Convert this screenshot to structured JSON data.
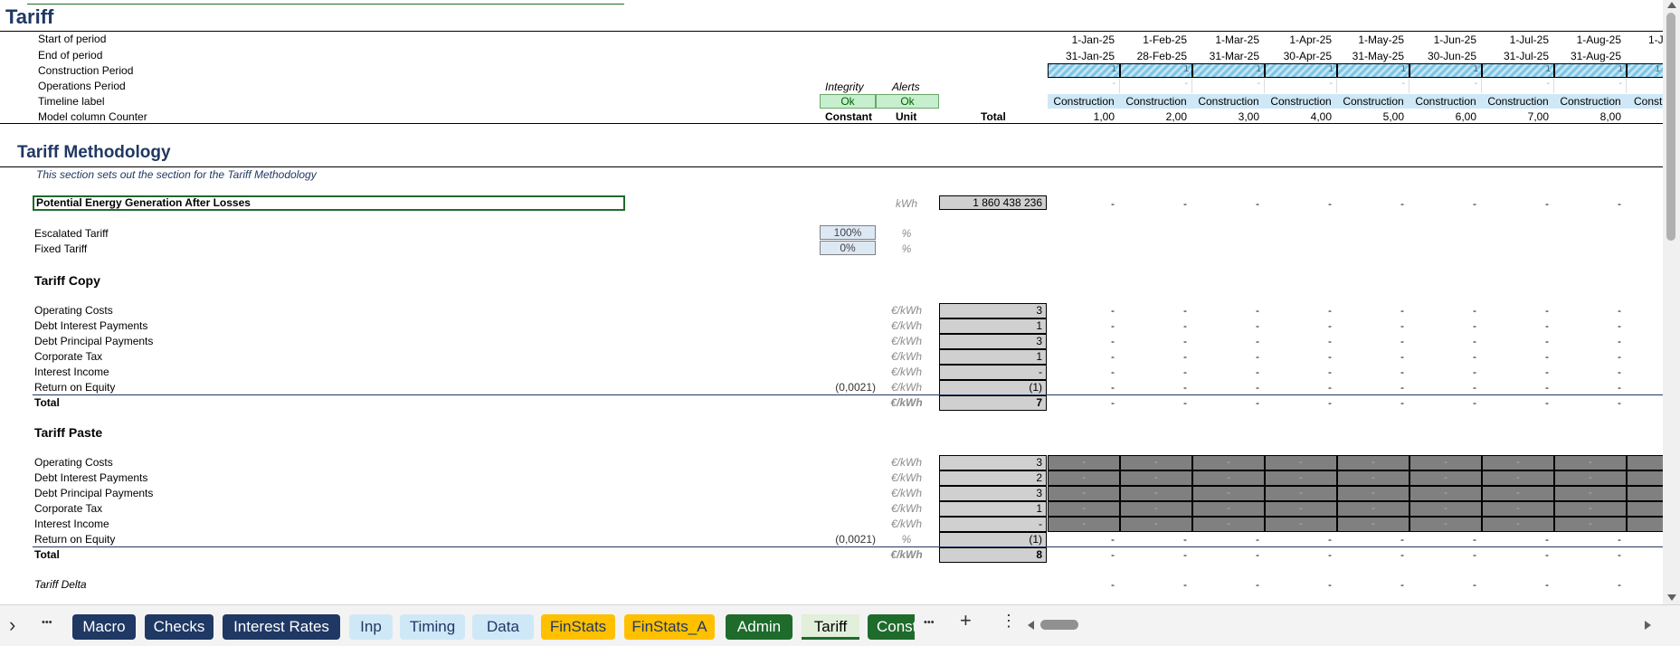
{
  "sheet_title": "Tariff",
  "timeline_labels": [
    "Start of period",
    "End of period",
    "Construction Period",
    "Operations Period",
    "Timeline label",
    "Model column Counter"
  ],
  "start_dates": [
    "1-Jan-25",
    "1-Feb-25",
    "1-Mar-25",
    "1-Apr-25",
    "1-May-25",
    "1-Jun-25",
    "1-Jul-25",
    "1-Aug-25"
  ],
  "end_dates": [
    "31-Jan-25",
    "28-Feb-25",
    "31-Mar-25",
    "30-Apr-25",
    "31-May-25",
    "30-Jun-25",
    "31-Jul-25",
    "31-Aug-25"
  ],
  "construction_flag": "1",
  "ops_flag": "-",
  "timeline_label_value": "Construction",
  "counters": [
    "1,00",
    "2,00",
    "3,00",
    "4,00",
    "5,00",
    "6,00",
    "7,00",
    "8,00"
  ],
  "integrity_header": "Integrity",
  "alerts_header": "Alerts",
  "integrity_status": "Ok",
  "alerts_status": "Ok",
  "constant_header": "Constant",
  "unit_header": "Unit",
  "total_header": "Total",
  "methodology": {
    "title": "Tariff Methodology",
    "description": "This section sets out the section for the Tariff Methodology",
    "energy_label": "Potential Energy Generation After Losses",
    "energy_unit": "kWh",
    "energy_total": "1 860 438 236",
    "escalated_label": "Escalated Tariff",
    "escalated_value": "100%",
    "fixed_label": "Fixed Tariff",
    "fixed_value": "0%",
    "pct_unit": "%"
  },
  "dash": "-",
  "tariff_copy": {
    "title": "Tariff Copy",
    "rows": [
      {
        "label": "Operating Costs",
        "unit": "€/kWh",
        "total": "3",
        "constant": ""
      },
      {
        "label": "Debt Interest  Payments",
        "unit": "€/kWh",
        "total": "1",
        "constant": ""
      },
      {
        "label": "Debt Principal  Payments",
        "unit": "€/kWh",
        "total": "3",
        "constant": ""
      },
      {
        "label": "Corporate Tax",
        "unit": "€/kWh",
        "total": "1",
        "constant": ""
      },
      {
        "label": "Interest Income",
        "unit": "€/kWh",
        "total": "-",
        "constant": ""
      },
      {
        "label": "Return on Equity",
        "unit": "€/kWh",
        "total": "(1)",
        "constant": "(0,0021)"
      }
    ],
    "total_label": "Total",
    "total_unit": "€/kWh",
    "total_value": "7"
  },
  "tariff_paste": {
    "title": "Tariff Paste",
    "rows": [
      {
        "label": "Operating Costs",
        "unit": "€/kWh",
        "total": "3",
        "constant": ""
      },
      {
        "label": "Debt Interest  Payments",
        "unit": "€/kWh",
        "total": "2",
        "constant": ""
      },
      {
        "label": "Debt Principal  Payments",
        "unit": "€/kWh",
        "total": "3",
        "constant": ""
      },
      {
        "label": "Corporate Tax",
        "unit": "€/kWh",
        "total": "1",
        "constant": ""
      },
      {
        "label": "Interest Income",
        "unit": "€/kWh",
        "total": "-",
        "constant": ""
      },
      {
        "label": "Return on Equity",
        "unit": "%",
        "total": "(1)",
        "constant": "(0,0021)"
      }
    ],
    "total_label": "Total",
    "total_unit": "€/kWh",
    "total_value": "8"
  },
  "tariff_delta_label": "Tariff Delta",
  "tabs": [
    {
      "label": "Macro",
      "bg": "#1f3864",
      "fg": "#ffffff"
    },
    {
      "label": "Checks",
      "bg": "#1f3864",
      "fg": "#ffffff"
    },
    {
      "label": "Interest Rates",
      "bg": "#1f3864",
      "fg": "#ffffff"
    },
    {
      "label": "Inp",
      "bg": "#cfe8f7",
      "fg": "#1f3864"
    },
    {
      "label": "Timing",
      "bg": "#cfe8f7",
      "fg": "#1f3864"
    },
    {
      "label": "Data",
      "bg": "#cfe8f7",
      "fg": "#1f3864"
    },
    {
      "label": "FinStats",
      "bg": "#ffc000",
      "fg": "#1f3864"
    },
    {
      "label": "FinStats_A",
      "bg": "#ffc000",
      "fg": "#1f3864"
    },
    {
      "label": "Admin",
      "bg": "#1e6b2c",
      "fg": "#ffffff"
    },
    {
      "label": "Tariff",
      "bg": "#e2efda",
      "fg": "#000000"
    },
    {
      "label": "Const",
      "bg": "#1e6b2c",
      "fg": "#ffffff"
    }
  ],
  "tab_more": "•••",
  "tab_add": "+",
  "tab_menu": "⋮",
  "nav_next": "›"
}
